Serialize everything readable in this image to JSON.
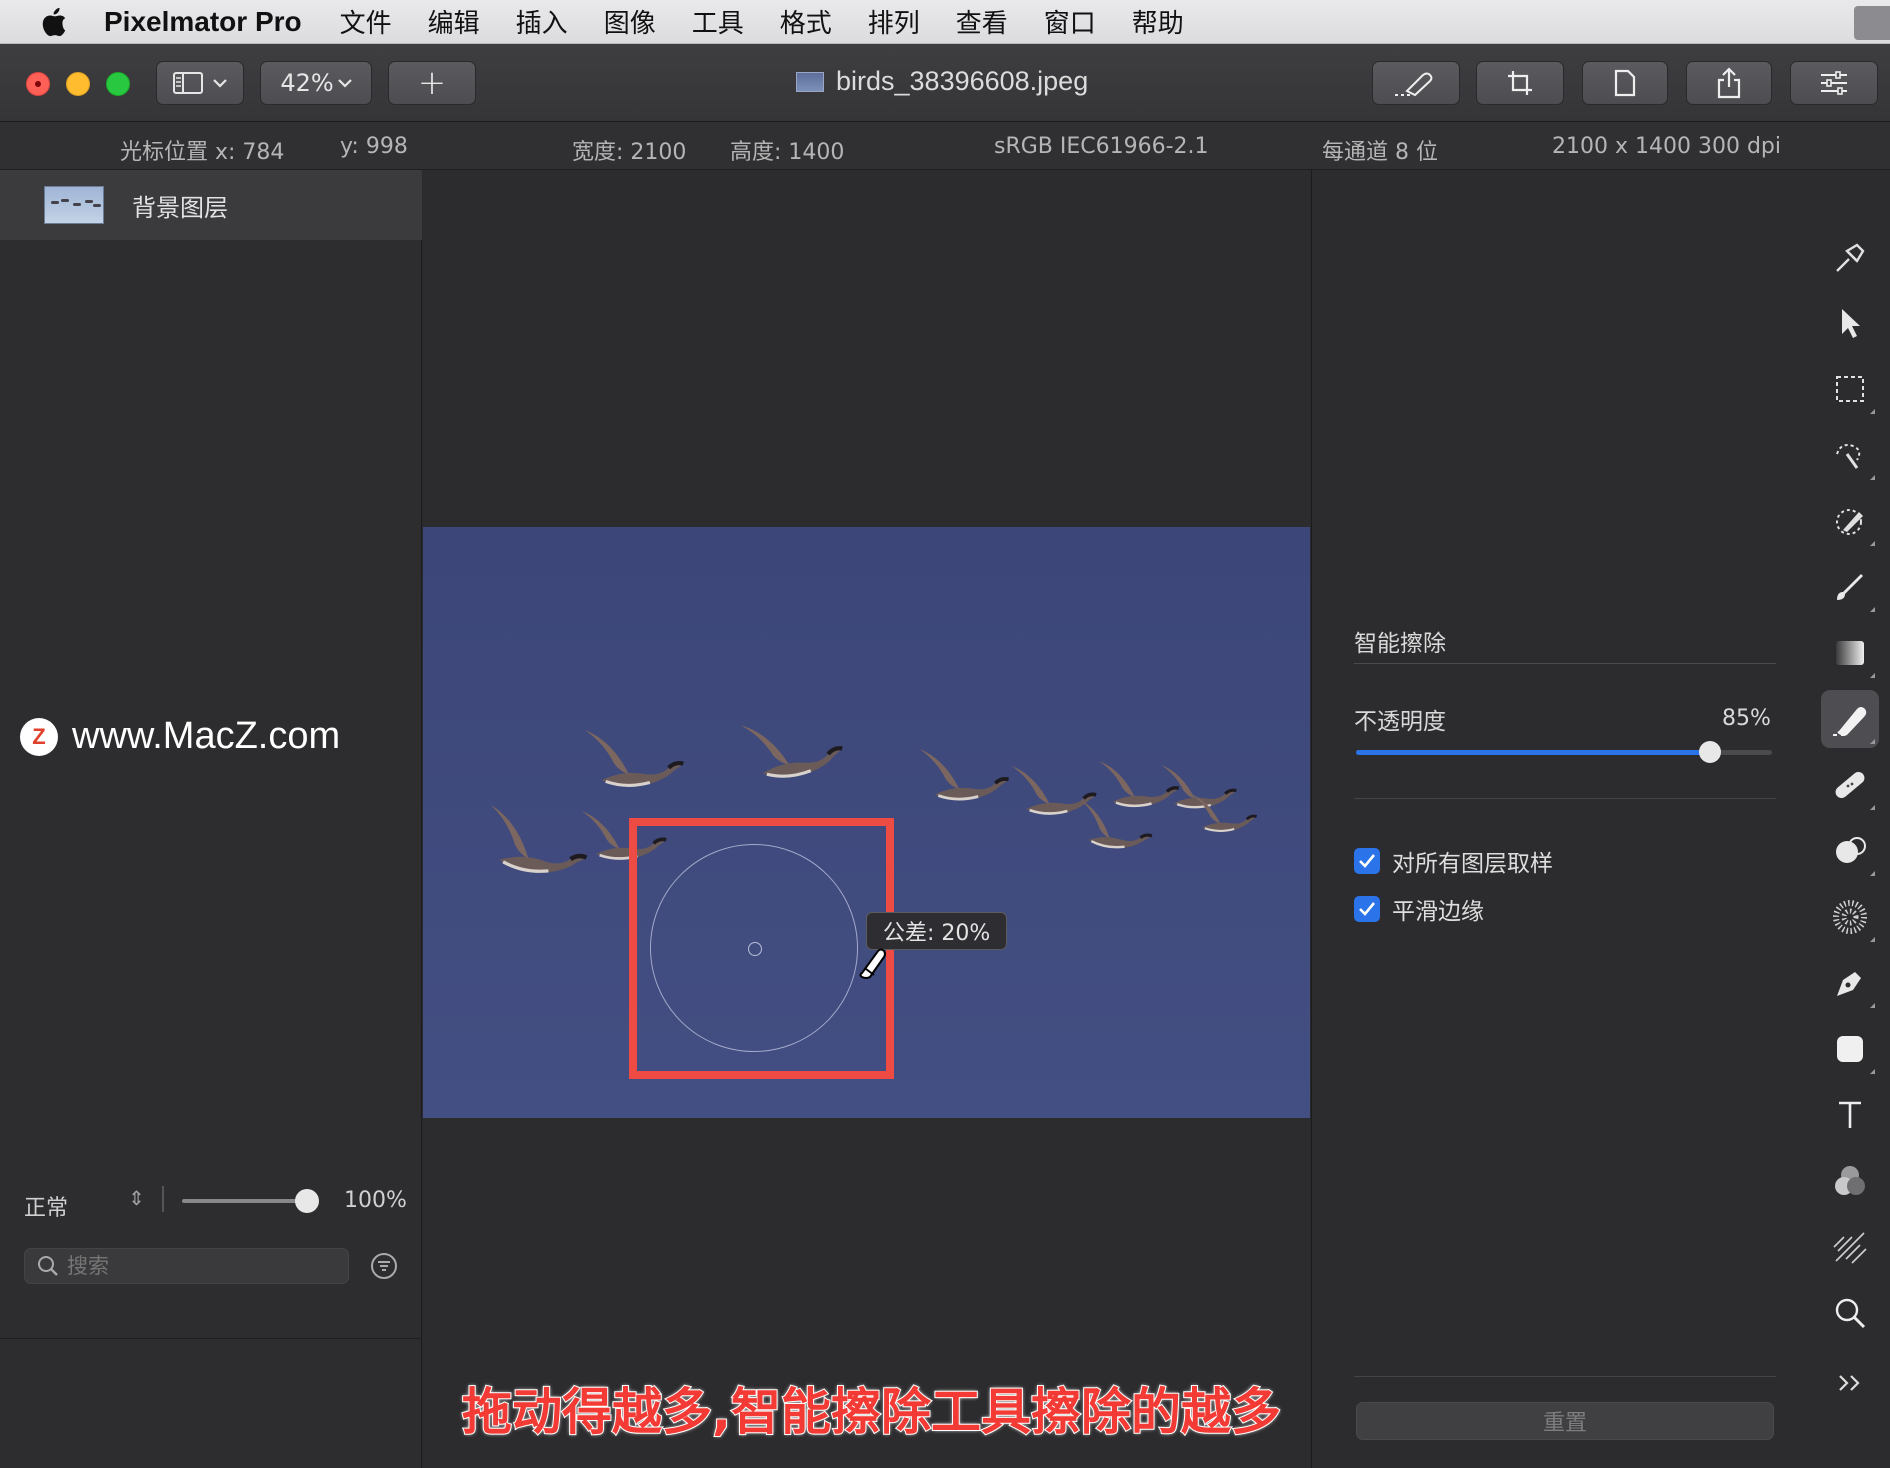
{
  "menubar": {
    "app_name": "Pixelmator Pro",
    "items": [
      "文件",
      "编辑",
      "插入",
      "图像",
      "工具",
      "格式",
      "排列",
      "查看",
      "窗口",
      "帮助"
    ]
  },
  "toolbar": {
    "zoom_label": "42%",
    "add_label": "+",
    "document_title": "birds_38396608.jpeg"
  },
  "infobar": {
    "cursor_x": "光标位置 x: 784",
    "cursor_y": "y: 998",
    "width": "宽度: 2100",
    "height": "高度: 1400",
    "color_profile": "sRGB IEC61966-2.1",
    "bit_depth": "每通道 8 位",
    "dimensions_dpi": "2100 x 1400 300 dpi"
  },
  "layers": {
    "items": [
      {
        "label": "背景图层"
      }
    ],
    "blend_mode": "正常",
    "opacity": "100%",
    "opacity_fraction": 1.0,
    "search_placeholder": "搜索"
  },
  "watermark": {
    "logo_letter": "Z",
    "text": "www.MacZ.com"
  },
  "canvas": {
    "tolerance_tooltip": "公差: 20%",
    "caption": "拖动得越多,智能擦除工具擦除的越多"
  },
  "inspector": {
    "tool_title": "智能擦除",
    "opacity_label": "不透明度",
    "opacity_value": "85%",
    "opacity_fraction": 0.85,
    "sample_all_layers": {
      "label": "对所有图层取样",
      "checked": true
    },
    "smooth_edges": {
      "label": "平滑边缘",
      "checked": true
    },
    "reset_label": "重置"
  },
  "tools": [
    {
      "name": "arrange-tool-icon"
    },
    {
      "name": "pointer-icon"
    },
    {
      "name": "rect-select-icon"
    },
    {
      "name": "magic-select-icon"
    },
    {
      "name": "color-picker-icon"
    },
    {
      "name": "paint-brush-icon"
    },
    {
      "name": "gradient-icon"
    },
    {
      "name": "smart-erase-icon",
      "active": true
    },
    {
      "name": "repair-bandage-icon"
    },
    {
      "name": "clone-icon"
    },
    {
      "name": "blur-icon"
    },
    {
      "name": "pen-icon"
    },
    {
      "name": "shape-icon"
    },
    {
      "name": "type-icon"
    },
    {
      "name": "color-adjust-icon"
    },
    {
      "name": "effects-icon"
    },
    {
      "name": "zoom-icon"
    },
    {
      "name": "more-tools-icon"
    }
  ],
  "colors": {
    "accent": "#2a73e8",
    "highlight": "#ee4b45",
    "image_sky": "#3f4a7c",
    "caption": "#f33a34"
  }
}
